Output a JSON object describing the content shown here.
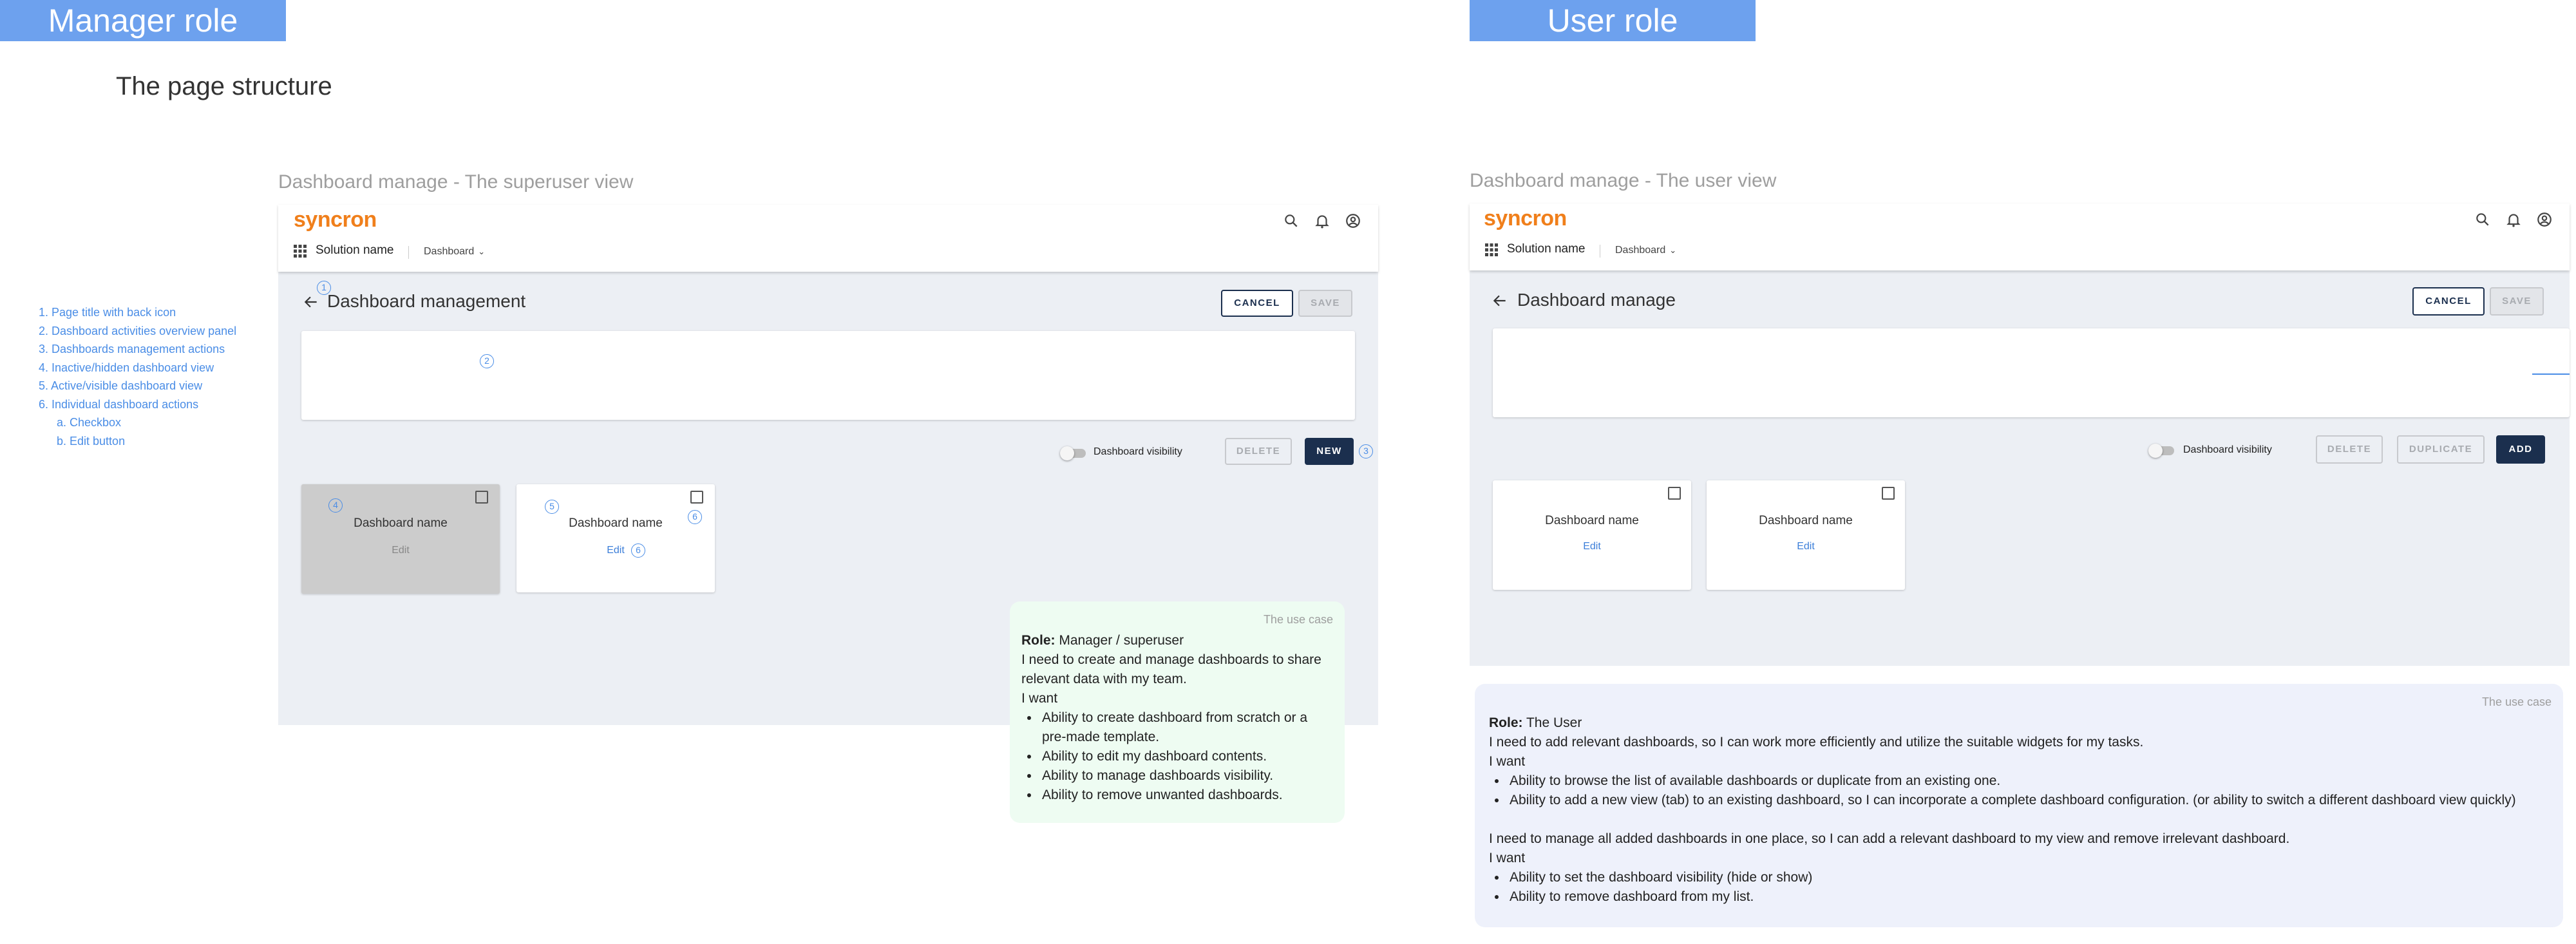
{
  "manager_role": {
    "tag": "Manager role",
    "page_structure": "The page structure",
    "view_title": "Dashboard manage - The superuser view",
    "legend": [
      "1. Page title with back icon",
      "2. Dashboard activities overview panel",
      "3. Dashboards management actions",
      "4. Inactive/hidden dashboard view",
      "5. Active/visible dashboard view",
      "6. Individual dashboard actions"
    ],
    "legend_sub": [
      "a. Checkbox",
      "b. Edit button"
    ],
    "app": {
      "logo": "syncron",
      "solution": "Solution name",
      "nav": "Dashboard",
      "page_title": "Dashboard management",
      "cancel": "CANCEL",
      "save": "SAVE",
      "visibility": "Dashboard visibility",
      "delete": "DELETE",
      "new": "NEW",
      "card_name": "Dashboard name",
      "edit": "Edit"
    },
    "badges": [
      "1",
      "2",
      "3",
      "4",
      "5",
      "6"
    ],
    "usecase": {
      "label": "The use case",
      "role_label": "Role:",
      "role_value": " Manager /  superuser",
      "need": "I need to create and manage dashboards to share relevant data with my team.",
      "want": "I want",
      "bullets": [
        "Ability to create dashboard from scratch or a pre-made template.",
        "Ability to edit my dashboard contents.",
        "Ability to manage dashboards visibility.",
        "Ability to remove unwanted dashboards."
      ]
    }
  },
  "user_role": {
    "tag": "User role",
    "view_title": "Dashboard manage - The user view",
    "app": {
      "logo": "syncron",
      "solution": "Solution name",
      "nav": "Dashboard",
      "page_title": "Dashboard manage",
      "cancel": "CANCEL",
      "save": "SAVE",
      "visibility": "Dashboard visibility",
      "delete": "DELETE",
      "duplicate": "DUPLICATE",
      "add": "ADD",
      "card_name": "Dashboard name",
      "edit": "Edit"
    },
    "usecase": {
      "label": "The use case",
      "role_label": "Role:",
      "role_value": " The User",
      "need1": "I need to add relevant dashboards, so I can work more efficiently and utilize the suitable widgets for my tasks.",
      "want": "I want",
      "bullets1": [
        "Ability to browse the list of available dashboards or duplicate from an existing one.",
        "Ability to add a new view (tab) to an existing dashboard, so I can incorporate a complete dashboard configuration. (or ability to switch a different dashboard view quickly)"
      ],
      "need2": "I need to manage all added dashboards in one place, so I can add a relevant dashboard to my view and remove irrelevant dashboard.",
      "bullets2": [
        "Ability to set the dashboard visibility (hide or show)",
        "Ability to remove dashboard from my list."
      ]
    }
  },
  "colors": {
    "role_tag": "#6da1ee",
    "annotation": "#4a8de6",
    "brand": "#f07f1b",
    "primary_button": "#1b2f4e",
    "frame_background": "#eceff4",
    "manager_usecase_background": "#eefcf2",
    "user_usecase_background": "#eef1fb"
  }
}
